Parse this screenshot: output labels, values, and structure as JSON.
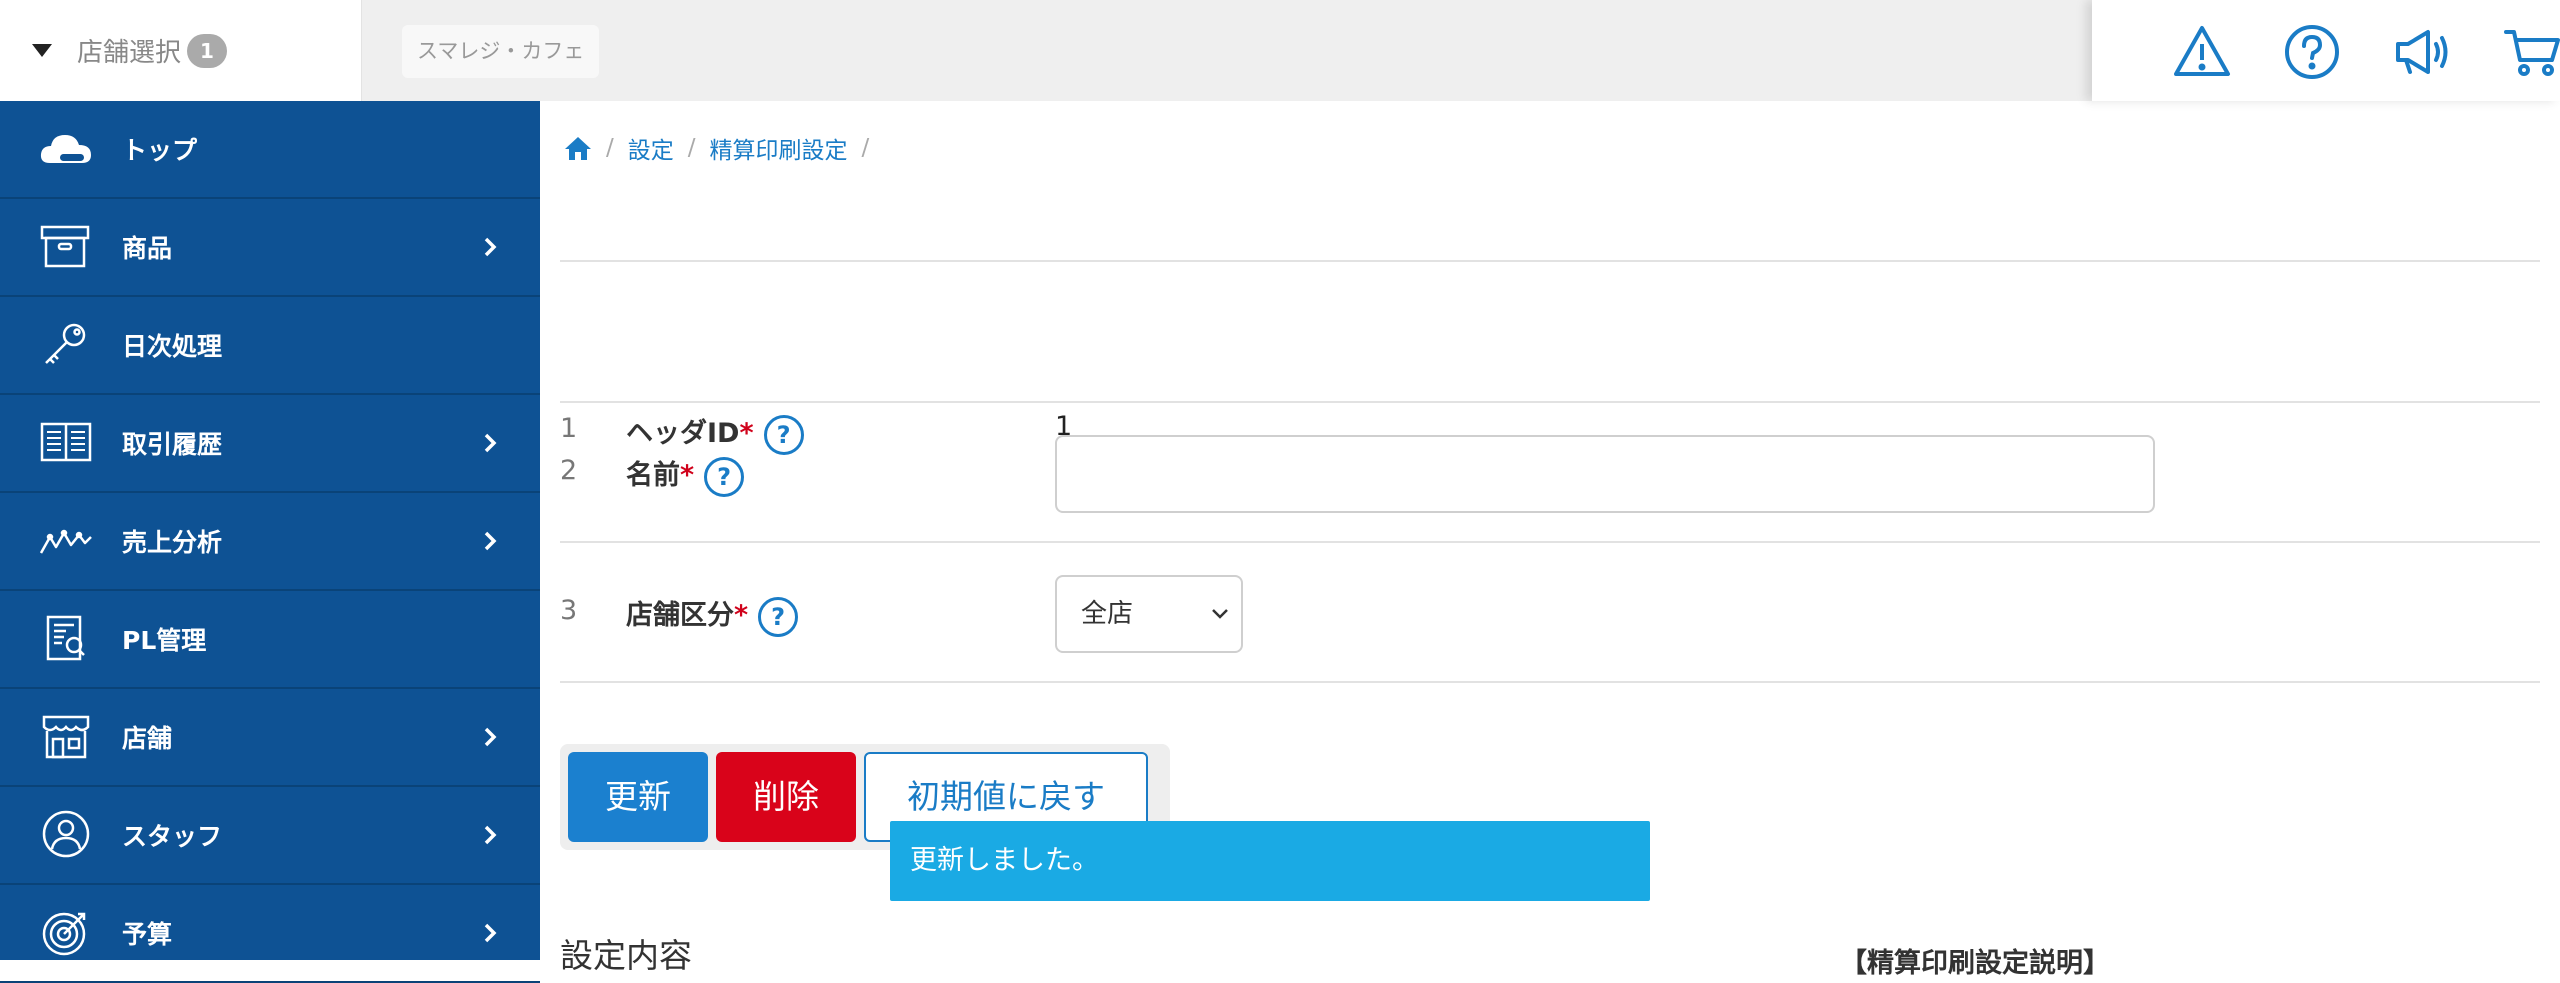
{
  "header": {
    "store_select_label": "店舗選択",
    "store_select_count": "1",
    "shop_name": "スマレジ・カフェ",
    "icons": [
      "alert-icon",
      "help-icon",
      "announcement-icon",
      "cart-icon"
    ],
    "accent_color": "#1a7cc6"
  },
  "sidebar": {
    "background": "#0e5294",
    "items": [
      {
        "label": "トップ",
        "icon": "cloud-icon",
        "has_submenu": false
      },
      {
        "label": "商品",
        "icon": "box-icon",
        "has_submenu": true
      },
      {
        "label": "日次処理",
        "icon": "key-icon",
        "has_submenu": false
      },
      {
        "label": "取引履歴",
        "icon": "book-icon",
        "has_submenu": true
      },
      {
        "label": "売上分析",
        "icon": "chart-line-icon",
        "has_submenu": true
      },
      {
        "label": "PL管理",
        "icon": "report-icon",
        "has_submenu": false
      },
      {
        "label": "店舗",
        "icon": "store-icon",
        "has_submenu": true
      },
      {
        "label": "スタッフ",
        "icon": "user-icon",
        "has_submenu": true
      },
      {
        "label": "予算",
        "icon": "target-icon",
        "has_submenu": true
      }
    ]
  },
  "breadcrumb": {
    "items": [
      "設定",
      "精算印刷設定"
    ],
    "separator": "/"
  },
  "form": {
    "rows": [
      {
        "num": "1",
        "label": "ヘッダID",
        "required_mark": "*",
        "value": "1"
      },
      {
        "num": "2",
        "label": "名前",
        "required_mark": "*",
        "value": "",
        "placeholder": ""
      },
      {
        "num": "3",
        "label": "店舗区分",
        "required_mark": "*",
        "selected": "全店"
      }
    ],
    "help_mark": "?"
  },
  "buttons": {
    "update": "更新",
    "delete": "削除",
    "reset": "初期値に戻す"
  },
  "toast": {
    "message": "更新しました。"
  },
  "section": {
    "title": "設定内容",
    "desc_title": "【精算印刷設定説明】"
  }
}
